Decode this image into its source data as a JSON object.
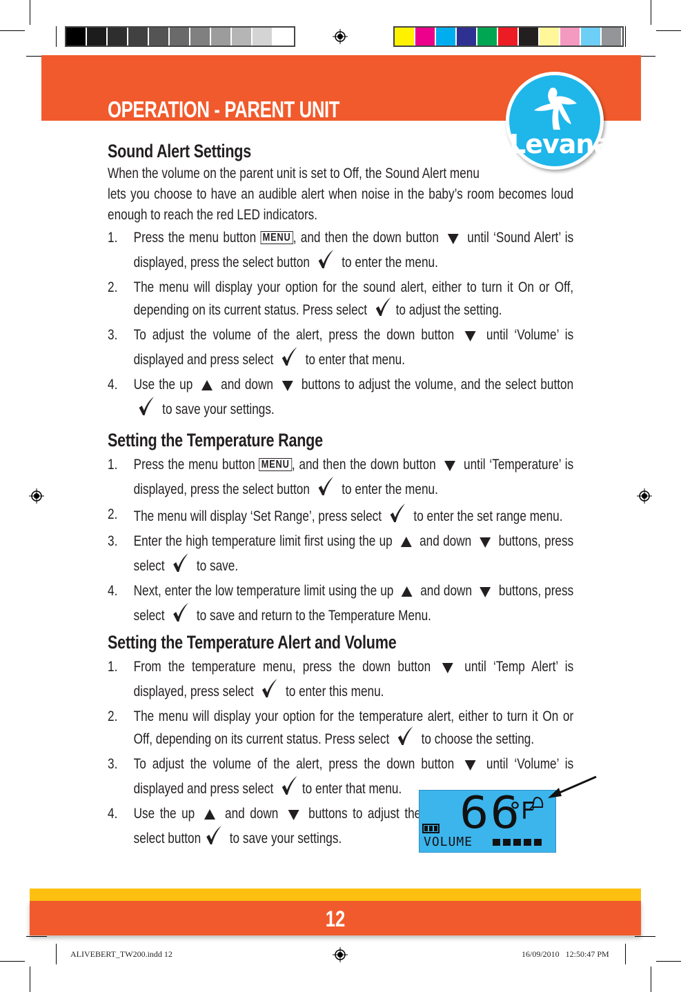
{
  "header": {
    "title": "OPERATION - PARENT UNIT",
    "logo_text": "Levana",
    "colors": {
      "band": "#f15a2c",
      "logo": "#1fb6ea"
    }
  },
  "print_marks": {
    "gray_swatches": [
      "#000000",
      "#1c1c1c",
      "#2e2e2e",
      "#414141",
      "#545454",
      "#6a6a6a",
      "#808080",
      "#9c9c9c",
      "#b5b5b5",
      "#d4d4d4",
      "#ffffff"
    ],
    "color_swatches": [
      "#fff200",
      "#ec008c",
      "#00aeef",
      "#2e3192",
      "#00a651",
      "#ed1c24",
      "#231f20",
      "#fff799",
      "#f49ac1",
      "#6dcff6",
      "#939598"
    ],
    "slug_left": "ALIVEBERT_TW200.indd   12",
    "slug_right": "16/09/2010   12:50:47 PM"
  },
  "sections": [
    {
      "heading": "Sound Alert Settings",
      "intro": [
        "When the volume on the parent unit is set to Off, the Sound Alert menu",
        "lets you choose to have an audible alert when noise in the baby’s room becomes loud enough to reach the red LED indicators."
      ],
      "items": [
        {
          "num": "1.",
          "parts": [
            {
              "t": "Press the menu button "
            },
            {
              "icon": "menu",
              "t": "MENU"
            },
            {
              "t": ", and then the down button "
            },
            {
              "icon": "down"
            },
            {
              "t": " until ‘Sound Alert’ is displayed, press the select button "
            },
            {
              "icon": "check"
            },
            {
              "t": " to enter the menu."
            }
          ]
        },
        {
          "num": "2.",
          "parts": [
            {
              "t": "The menu will display your option for the sound alert, either to turn it On or Off, depending on its current status. Press select "
            },
            {
              "icon": "check"
            },
            {
              "t": "to adjust the setting."
            }
          ]
        },
        {
          "num": "3.",
          "parts": [
            {
              "t": "To adjust the volume of the alert, press the down button "
            },
            {
              "icon": "down"
            },
            {
              "t": " until ‘Volume’ is displayed and press select "
            },
            {
              "icon": "check"
            },
            {
              "t": " to enter that menu."
            }
          ]
        },
        {
          "num": "4.",
          "parts": [
            {
              "t": "Use the up "
            },
            {
              "icon": "up"
            },
            {
              "t": " and down "
            },
            {
              "icon": "down"
            },
            {
              "t": " buttons to adjust the volume, and the select button "
            },
            {
              "icon": "check"
            },
            {
              "t": " to save your settings."
            }
          ]
        }
      ]
    },
    {
      "heading": "Setting the Temperature Range",
      "items": [
        {
          "num": "1.",
          "parts": [
            {
              "t": "Press the menu button "
            },
            {
              "icon": "menu",
              "t": "MENU"
            },
            {
              "t": ", and then the down button "
            },
            {
              "icon": "down"
            },
            {
              "t": " until ‘Temperature’ is displayed, press the select button "
            },
            {
              "icon": "check"
            },
            {
              "t": " to enter the menu."
            }
          ]
        },
        {
          "num": "2.",
          "parts": [
            {
              "t": "The menu will display ‘Set Range’, press select "
            },
            {
              "icon": "check"
            },
            {
              "t": " to enter the set range menu."
            }
          ]
        },
        {
          "num": "3.",
          "parts": [
            {
              "t": "Enter the high temperature limit first using the up "
            },
            {
              "icon": "up"
            },
            {
              "t": " and down "
            },
            {
              "icon": "down"
            },
            {
              "t": " buttons, press select "
            },
            {
              "icon": "check"
            },
            {
              "t": " to save."
            }
          ]
        },
        {
          "num": "4.",
          "parts": [
            {
              "t": "Next, enter the low temperature limit using the up "
            },
            {
              "icon": "up"
            },
            {
              "t": " and down "
            },
            {
              "icon": "down"
            },
            {
              "t": " buttons, press select "
            },
            {
              "icon": "check"
            },
            {
              "t": " to save and return to the Temperature Menu."
            }
          ]
        }
      ]
    },
    {
      "heading": "Setting the  Temperature Alert and Volume",
      "items": [
        {
          "num": "1.",
          "parts": [
            {
              "t": "From the temperature menu, press the down button "
            },
            {
              "icon": "down"
            },
            {
              "t": " until ‘Temp Alert’ is displayed, press select "
            },
            {
              "icon": "check"
            },
            {
              "t": " to enter this menu."
            }
          ]
        },
        {
          "num": "2.",
          "parts": [
            {
              "t": "The menu will display your option for the temperature alert, either to turn it On or Off, depending on its current status. Press select "
            },
            {
              "icon": "check"
            },
            {
              "t": " to choose the setting."
            }
          ]
        },
        {
          "num": "3.",
          "parts": [
            {
              "t": "To adjust the volume of the alert, press the down button "
            },
            {
              "icon": "down"
            },
            {
              "t": " until ‘Volume’ is displayed and press select "
            },
            {
              "icon": "check"
            },
            {
              "t": "to enter that menu."
            }
          ]
        },
        {
          "num": "4.",
          "narrow": true,
          "parts": [
            {
              "t": "Use the up "
            },
            {
              "icon": "up"
            },
            {
              "t": " and down "
            },
            {
              "icon": "down"
            },
            {
              "t": " buttons to adjust the volume, and the select button"
            },
            {
              "icon": "check"
            },
            {
              "t": " to save your settings."
            }
          ]
        }
      ]
    }
  ],
  "lcd": {
    "temperature": "66",
    "unit": "°F",
    "label": "VOLUME",
    "volume_level": 5,
    "volume_max": 5,
    "battery_bars": 3,
    "bell_icon": "bell-icon",
    "color": "#3cb4ec"
  },
  "footer": {
    "page_number": "12",
    "colors": {
      "top": "#fdc010",
      "band": "#f15a2c"
    }
  }
}
